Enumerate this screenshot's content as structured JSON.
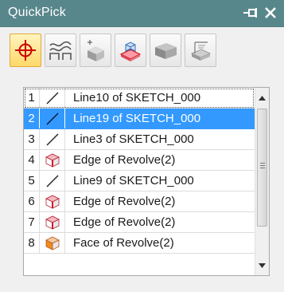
{
  "window": {
    "title": "QuickPick",
    "pin_icon": "pin-icon",
    "close_icon": "close-icon"
  },
  "toolbar": {
    "buttons": [
      {
        "icon": "crosshair-filter-icon",
        "active": true
      },
      {
        "icon": "curve-filter-icon",
        "active": false
      },
      {
        "icon": "point-on-body-icon",
        "active": false
      },
      {
        "icon": "body-filter-icon",
        "active": false
      },
      {
        "icon": "solid-body-icon",
        "active": false
      },
      {
        "icon": "sheet-body-icon",
        "active": false
      }
    ]
  },
  "list": {
    "rows": [
      {
        "num": "1",
        "icon": "line-icon",
        "label": "Line10 of SKETCH_000",
        "selected": false,
        "focused": true
      },
      {
        "num": "2",
        "icon": "line-icon",
        "label": "Line19 of SKETCH_000",
        "selected": true,
        "focused": false
      },
      {
        "num": "3",
        "icon": "line-icon",
        "label": "Line3 of SKETCH_000",
        "selected": false,
        "focused": false
      },
      {
        "num": "4",
        "icon": "edge-icon",
        "label": "Edge of Revolve(2)",
        "selected": false,
        "focused": false
      },
      {
        "num": "5",
        "icon": "line-icon",
        "label": "Line9 of SKETCH_000",
        "selected": false,
        "focused": false
      },
      {
        "num": "6",
        "icon": "edge-icon",
        "label": "Edge of Revolve(2)",
        "selected": false,
        "focused": false
      },
      {
        "num": "7",
        "icon": "edge-icon",
        "label": "Edge of Revolve(2)",
        "selected": false,
        "focused": false
      },
      {
        "num": "8",
        "icon": "face-icon",
        "label": "Face of Revolve(2)",
        "selected": false,
        "focused": false
      }
    ]
  },
  "colors": {
    "titlebar": "#58878b",
    "selection": "#3399ff",
    "active_tool": "#ffd86a"
  }
}
